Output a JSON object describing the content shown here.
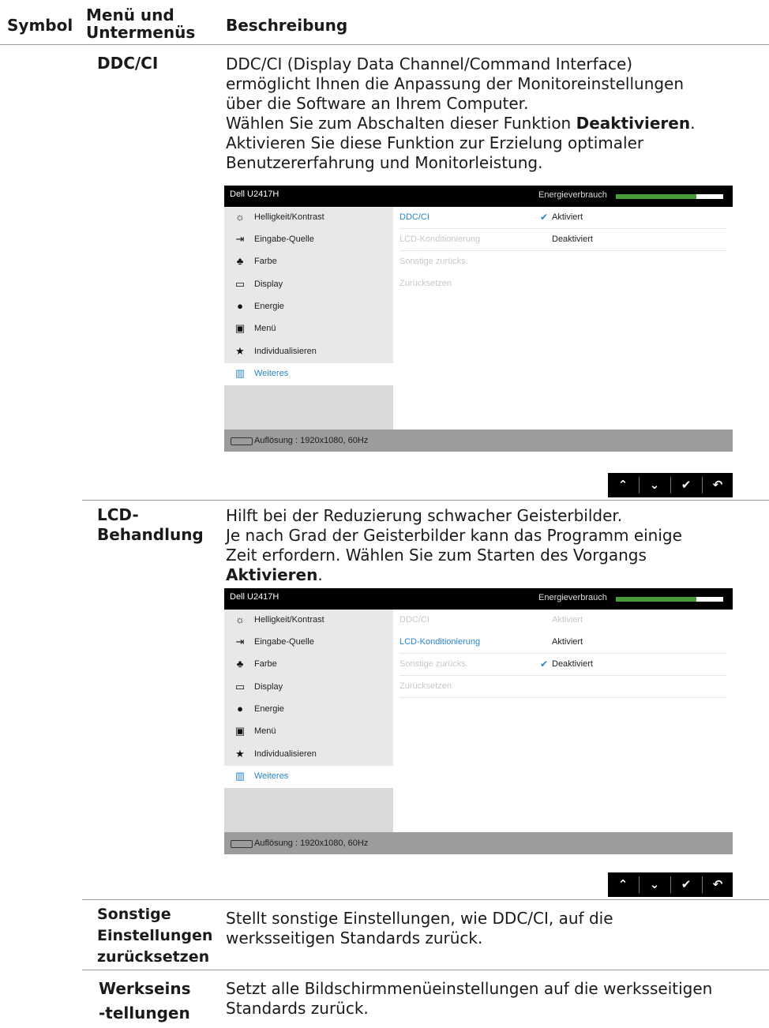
{
  "header": {
    "col_symbol": "Symbol",
    "col_menu_line1": "Menü und",
    "col_menu_line2": "Untermenüs",
    "col_desc": "Beschreibung"
  },
  "rows": {
    "ddcci": {
      "name": "DDC/CI",
      "line1": "DDC/CI (Display Data Channel/Command Interface)",
      "line2": "ermöglicht Ihnen die Anpassung der Monitoreinstellungen",
      "line3": "über die Software an Ihrem Computer.",
      "line4_pre": "Wählen Sie zum Abschalten dieser Funktion ",
      "line4_bold": "Deaktivieren",
      "line4_post": ".",
      "line5": "Aktivieren Sie diese Funktion zur Erzielung optimaler",
      "line6": "Benutzererfahrung und Monitorleistung."
    },
    "lcd": {
      "name_line1": "LCD-",
      "name_line2": "Behandlung",
      "line1": "Hilft bei der Reduzierung schwacher Geisterbilder.",
      "line2": "Je nach Grad der Geisterbilder kann das Programm einige",
      "line3": "Zeit erfordern. Wählen Sie zum Starten des Vorgangs",
      "line4_bold": "Aktivieren",
      "line4_post": "."
    },
    "reset_other": {
      "name_line1": "Sonstige",
      "name_line2": "Einstellungen",
      "name_line3": "zurücksetzen",
      "line1": "Stellt sonstige Einstellungen, wie DDC/CI, auf die",
      "line2": "werksseitigen Standards zurück."
    },
    "factory": {
      "name_line1": "Werkseins",
      "name_line2": "-tellungen",
      "line1": "Setzt alle Bildschirmmenüeinstellungen auf die werksseitigen",
      "line2": "Standards zurück."
    }
  },
  "osd": {
    "model": "Dell U2417H",
    "energy_label": "Energieverbrauch",
    "energy_level_percent": 85,
    "menu": [
      {
        "label": "Helligkeit/Kontrast",
        "icon": "brightness-icon"
      },
      {
        "label": "Eingabe-Quelle",
        "icon": "input-source-icon"
      },
      {
        "label": "Farbe",
        "icon": "color-icon"
      },
      {
        "label": "Display",
        "icon": "display-icon"
      },
      {
        "label": "Energie",
        "icon": "energy-icon"
      },
      {
        "label": "Menü",
        "icon": "menu-icon"
      },
      {
        "label": "Individualisieren",
        "icon": "star-icon"
      },
      {
        "label": "Weiteres",
        "icon": "others-icon"
      }
    ],
    "submenu": [
      "DDC/CI",
      "LCD-Konditionierung",
      "Sonstige zurücks.",
      "Zurücksetzen"
    ],
    "osd1": {
      "val1": "Aktiviert",
      "val2": "Deaktiviert"
    },
    "osd2": {
      "val1": "Aktiviert",
      "val2": "Aktiviert",
      "val3": "Deaktiviert"
    },
    "status": "Auflösung : 1920x1080, 60Hz"
  },
  "nav": {
    "up": "⌃",
    "down": "⌄",
    "ok": "✔",
    "back": "↶"
  },
  "colors": {
    "accent": "#2a86c8",
    "energy_green": "#4a9a3a"
  }
}
